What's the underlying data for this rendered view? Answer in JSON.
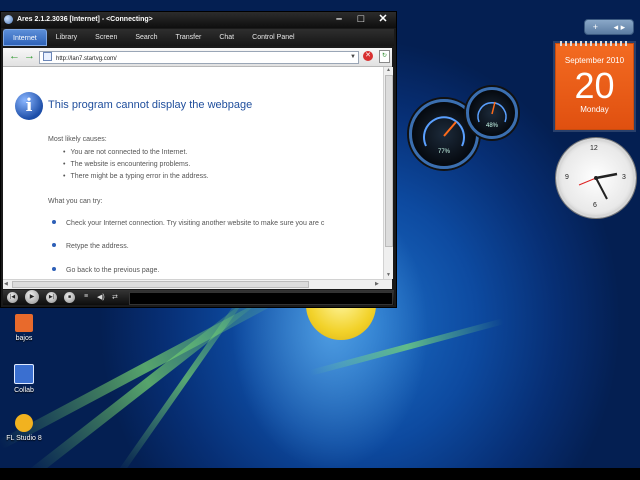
{
  "window": {
    "title": "Ares 2.1.2.3036  [Internet]  - <Connecting>",
    "minimize": "–",
    "maximize": "□",
    "close": "✕"
  },
  "tabs": [
    {
      "label": "Internet",
      "active": true
    },
    {
      "label": "Library"
    },
    {
      "label": "Screen"
    },
    {
      "label": "Search"
    },
    {
      "label": "Transfer"
    },
    {
      "label": "Chat"
    },
    {
      "label": "Control Panel"
    }
  ],
  "navbar": {
    "back": "←",
    "forward": "→",
    "url": "http://lan7.startvg.com/",
    "stop": "✕",
    "page": "↻"
  },
  "error_page": {
    "icon": "i",
    "heading": "This program cannot display the webpage",
    "causes_title": "Most likely causes:",
    "causes": [
      "You are not connected to the Internet.",
      "The website is encountering problems.",
      "There might be a typing error in the address."
    ],
    "try_title": "What you can try:",
    "actions": [
      "Check your Internet connection. Try visiting another website to make sure you are c",
      "Retype the address.",
      "Go back to the previous page."
    ]
  },
  "player": {
    "prev": "|◀",
    "play": "▶",
    "next": "▶|",
    "stop": "■",
    "playlist": "≡",
    "volume": "◀)",
    "shuffle": "⇄"
  },
  "desktop_icons": [
    {
      "label": "bajos",
      "color": "#e86a2c"
    },
    {
      "label": "Collab",
      "color": "#3a6fd0"
    },
    {
      "label": "FL Studio 8",
      "color": "#f2b21f"
    }
  ],
  "gadgets": {
    "controls": {
      "add": "+",
      "nav": "◂ ▸"
    },
    "calendar": {
      "month_year": "September 2010",
      "day": "20",
      "weekday": "Monday"
    },
    "meter": {
      "cpu": "77%",
      "mem": "48%"
    },
    "clock": {
      "numerals": [
        "12",
        "3",
        "6",
        "9"
      ]
    }
  }
}
